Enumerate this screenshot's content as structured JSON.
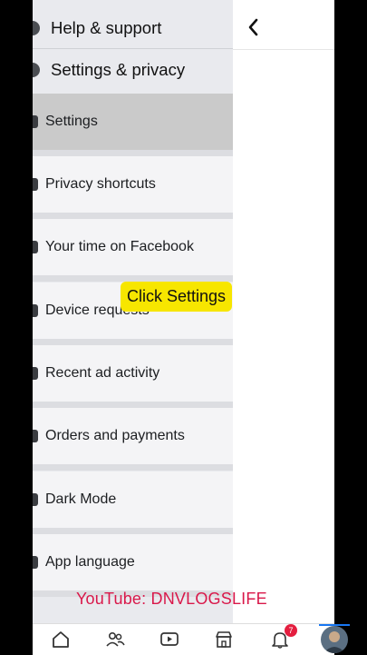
{
  "menu": {
    "sections": [
      {
        "label": "Help & support",
        "icon": "help-circle-icon"
      },
      {
        "label": "Settings & privacy",
        "icon": "gear-icon"
      }
    ],
    "items": [
      {
        "label": "Settings",
        "icon": "person-gear-icon"
      },
      {
        "label": "Privacy shortcuts",
        "icon": "lock-icon"
      },
      {
        "label": "Your time on Facebook",
        "icon": "clock-icon"
      },
      {
        "label": "Device requests",
        "icon": "phone-icon"
      },
      {
        "label": "Recent ad activity",
        "icon": "ad-icon"
      },
      {
        "label": "Orders and payments",
        "icon": "tag-icon"
      },
      {
        "label": "Dark Mode",
        "icon": "moon-icon"
      },
      {
        "label": "App language",
        "icon": "globe-icon"
      }
    ]
  },
  "overlay": {
    "caption": "Click Settings",
    "watermark": "YouTube: DNVLOGSLIFE"
  },
  "tabbar": {
    "notification_count": "7"
  },
  "colors": {
    "caption_bg": "#f7e600",
    "watermark": "#d9184a",
    "badge": "#e41e3f",
    "active_item": "#cacaca"
  }
}
